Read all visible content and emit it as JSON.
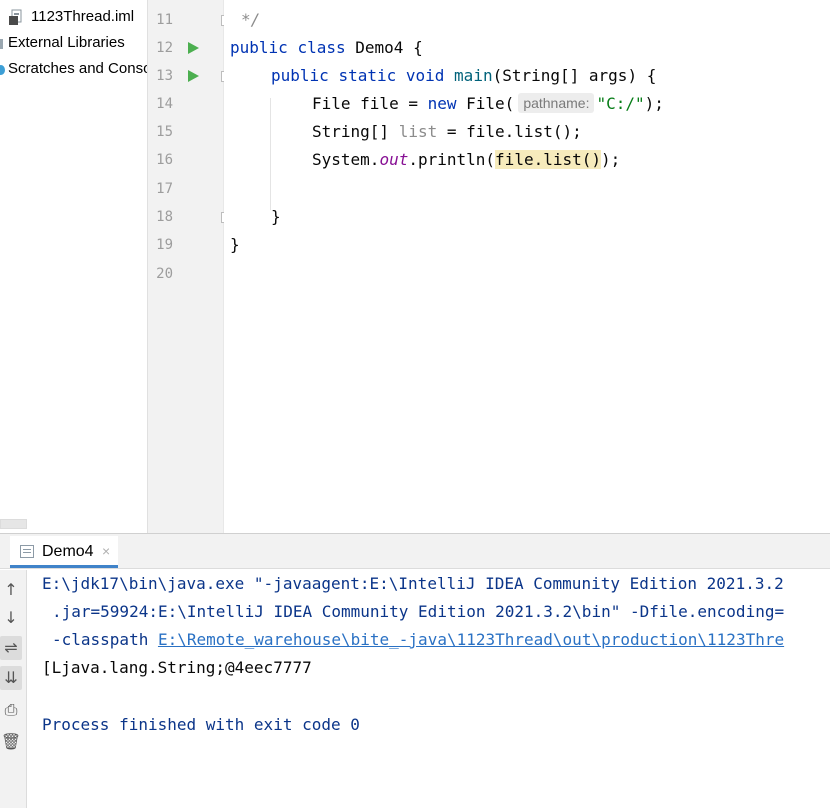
{
  "project_tree": {
    "items": [
      {
        "label": "1123Thread.iml",
        "icon": "iml-file-icon"
      },
      {
        "label": "External Libraries",
        "icon": "library-icon"
      },
      {
        "label": "Scratches and Consoles",
        "icon": "scratches-icon"
      }
    ]
  },
  "editor": {
    "line_numbers": [
      "11",
      "12",
      "13",
      "14",
      "15",
      "16",
      "17",
      "18",
      "19",
      "20"
    ],
    "current_line": "20",
    "run_markers": [
      "12",
      "13"
    ],
    "fold_markers": [
      "11",
      "13",
      "18"
    ],
    "lines": {
      "l11": {
        "comment": "*/"
      },
      "l12": {
        "kw_public": "public",
        "kw_class": "class",
        "class_name": "Demo4",
        "brace": "{"
      },
      "l13": {
        "kw_public": "public",
        "kw_static": "static",
        "kw_void": "void",
        "method": "main",
        "params": "(String[] args) {"
      },
      "l14": {
        "decl": "File file = ",
        "kw_new": "new",
        "call": "File(",
        "hint": "pathname:",
        "string": "\"C:/\"",
        "end": ");"
      },
      "l15": {
        "type": "String[] ",
        "var": "list",
        "rest": " = file.list();"
      },
      "l16": {
        "sys": "System.",
        "field": "out",
        "println": ".println(",
        "highlight": "file.list()",
        "end": ");"
      },
      "l18": {
        "brace": "}"
      },
      "l19": {
        "brace": "}"
      }
    }
  },
  "run_window": {
    "tab_label": "Demo4",
    "tab_close": "×",
    "toolbar": [
      {
        "name": "up-arrow-icon",
        "glyph": "↑"
      },
      {
        "name": "down-arrow-icon",
        "glyph": "↓"
      },
      {
        "name": "soft-wrap-icon",
        "glyph": "⇌"
      },
      {
        "name": "scroll-to-end-icon",
        "glyph": "⇊"
      },
      {
        "name": "print-icon",
        "glyph": "⎙"
      },
      {
        "name": "trash-icon",
        "glyph": "🗑"
      }
    ],
    "output": {
      "line1": "E:\\jdk17\\bin\\java.exe \"-javaagent:E:\\IntelliJ IDEA Community Edition 2021.3.2",
      "line2": ".jar=59924:E:\\IntelliJ IDEA Community Edition 2021.3.2\\bin\" -Dfile.encoding=",
      "line3_prefix": "-classpath ",
      "line3_link": "E:\\Remote_warehouse\\bite_-java\\1123Thread\\out\\production\\1123Thre",
      "line4": "[Ljava.lang.String;@4eec7777",
      "line6": "Process finished with exit code 0"
    }
  },
  "colors": {
    "keyword": "#0033b3",
    "string": "#067d17",
    "method": "#00627a",
    "field": "#871094",
    "console_text": "#0b3589",
    "link": "#2a71c4",
    "run_icon": "#4caf50",
    "current_line_bg": "#fcfaed",
    "highlight_bg": "#f6ebbc"
  }
}
